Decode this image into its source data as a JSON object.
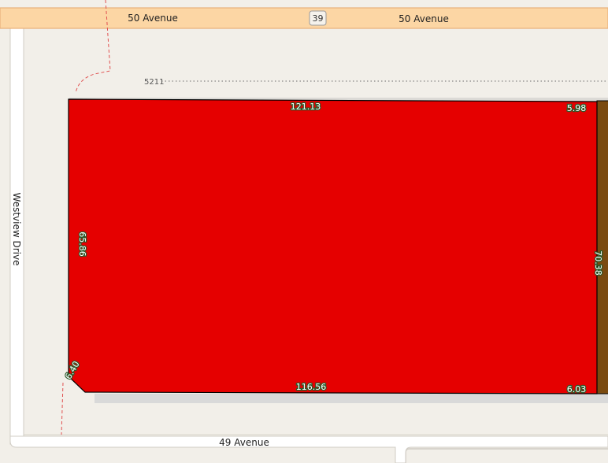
{
  "roads": {
    "north_left": "50 Avenue",
    "north_right": "50 Avenue",
    "north_shield": "39",
    "west": "Westview Drive",
    "south": "49 Avenue"
  },
  "address": "5211",
  "parcel": {
    "fill": "#e50000",
    "adjacent_fill": "#7a4a10",
    "dimensions": {
      "north": "121.13",
      "north_east": "5.98",
      "west": "65.86",
      "east": "70.38",
      "corner": "6.40",
      "south": "116.56",
      "south_east": "6.03"
    }
  },
  "colors": {
    "road_fill": "#fcd6a4",
    "road_casing": "#e8b07a",
    "background": "#f2efe9",
    "boundary_dash": "#e05050"
  }
}
